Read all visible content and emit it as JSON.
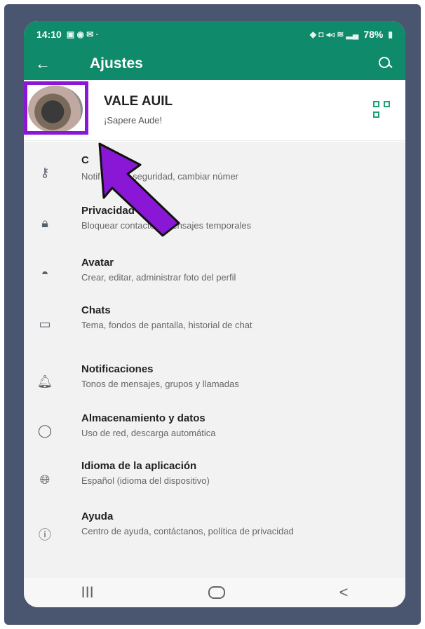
{
  "status_bar": {
    "time": "14:10",
    "battery": "78%"
  },
  "app_bar": {
    "back_icon": "back-arrow-icon",
    "title": "Ajustes",
    "search_icon": "search-icon"
  },
  "profile": {
    "name": "VALE AUIL",
    "status": "¡Sapere Aude!",
    "qr_icon": "qr-code-icon"
  },
  "settings": [
    {
      "icon": "key-icon",
      "title": "C",
      "subtitle": "Notif          nes de seguridad, cambiar númer"
    },
    {
      "icon": "lock-icon",
      "title": "Privacidad",
      "subtitle": "Bloquear contactos, mensajes temporales"
    },
    {
      "icon": "avatar-icon",
      "title": "Avatar",
      "subtitle": "Crear, editar, administrar foto del perfil"
    },
    {
      "icon": "chat-icon",
      "title": "Chats",
      "subtitle": "Tema, fondos de pantalla, historial de chat"
    },
    {
      "icon": "bell-icon",
      "title": "Notificaciones",
      "subtitle": "Tonos de mensajes, grupos y llamadas"
    },
    {
      "icon": "storage-icon",
      "title": "Almacenamiento y datos",
      "subtitle": "Uso de red, descarga automática"
    },
    {
      "icon": "globe-icon",
      "title": "Idioma de la aplicación",
      "subtitle": "Español (idioma del dispositivo)"
    },
    {
      "icon": "help-icon",
      "title": "Ayuda",
      "subtitle": "Centro de ayuda, contáctanos, política de privacidad"
    }
  ],
  "nav_bar": {
    "recents": "III",
    "back": "<"
  },
  "colors": {
    "header": "#0f8a6a",
    "highlight": "#8a17d6",
    "frame": "#4a5670"
  }
}
